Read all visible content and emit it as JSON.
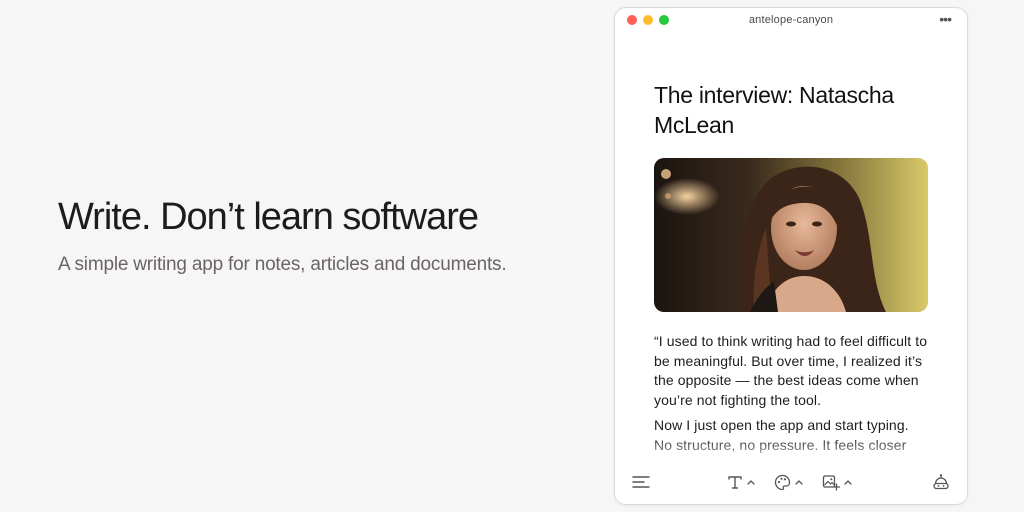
{
  "hero": {
    "title": "Write. Don’t learn software",
    "subtitle": "A simple writing app for notes, articles and documents."
  },
  "window": {
    "document_name": "antelope-canyon",
    "more_icon": "ellipsis-icon"
  },
  "article": {
    "title": "The interview: Natascha McLean",
    "image_icon": "portrait-photo",
    "paragraphs": [
      "“I used to think writing had to feel difficult to be meaningful. But over time, I realized it’s the opposite — the best ideas come when you’re not fighting the tool.",
      "Now I just open the app and start typing. No structure, no pressure. It feels closer"
    ]
  },
  "toolbar": {
    "icons": [
      "menu-icon",
      "text-format-icon",
      "palette-icon",
      "insert-image-icon",
      "assistant-icon"
    ]
  },
  "colors": {
    "traffic_red": "#fe5f57",
    "traffic_yellow": "#febc2e",
    "traffic_green": "#28c840",
    "background": "#f6f6f6"
  }
}
